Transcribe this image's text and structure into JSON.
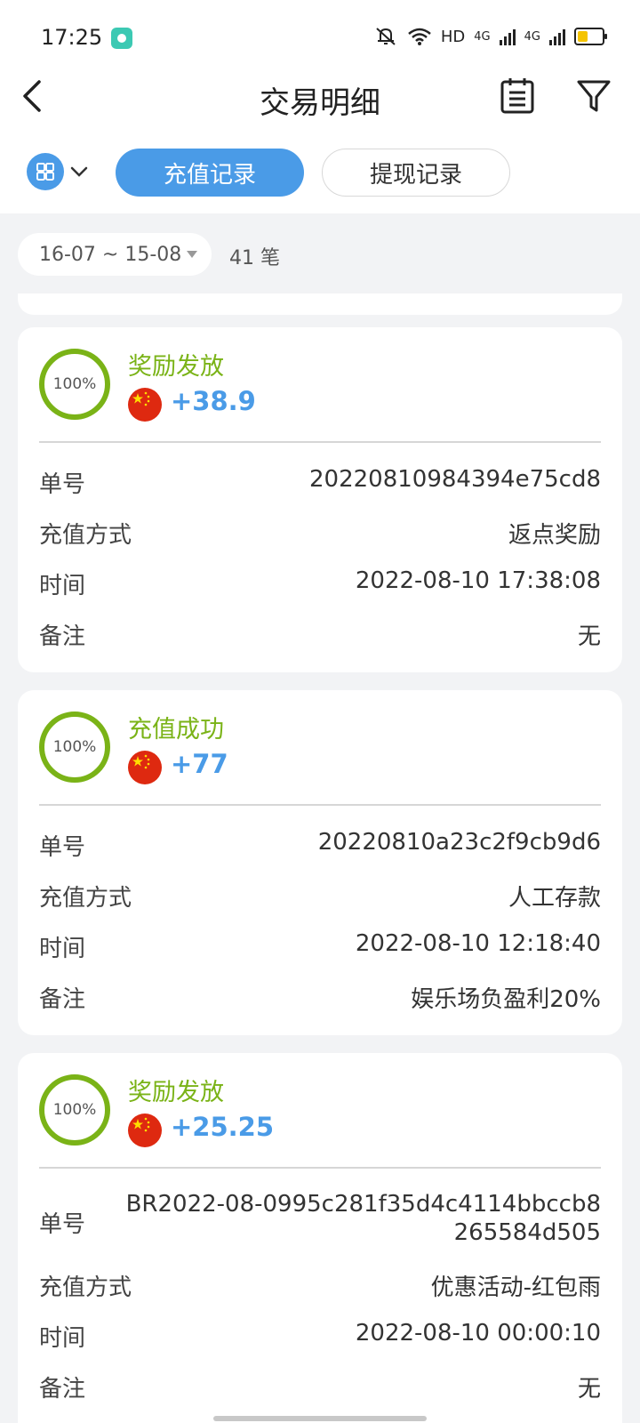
{
  "status_bar": {
    "time": "17:25",
    "network": "HD",
    "signal1": "4G",
    "signal2": "4G"
  },
  "header": {
    "title": "交易明细",
    "back_icon": "chevron-left-icon",
    "calendar_icon": "calendar-icon",
    "filter_icon": "filter-icon"
  },
  "tabs": {
    "recharge": "充值记录",
    "withdraw": "提现记录"
  },
  "filter": {
    "date_range": "16-07 ~ 15-08",
    "count": "41 笔"
  },
  "labels": {
    "order_no": "单号",
    "method": "充值方式",
    "time": "时间",
    "note": "备注"
  },
  "records": [
    {
      "progress": "100%",
      "status": "奖励发放",
      "amount": "+38.9",
      "order_no": "20220810984394e75cd8",
      "method": "返点奖励",
      "time": "2022-08-10 17:38:08",
      "note": "无"
    },
    {
      "progress": "100%",
      "status": "充值成功",
      "amount": "+77",
      "order_no": "20220810a23c2f9cb9d6",
      "method": "人工存款",
      "time": "2022-08-10 12:18:40",
      "note": "娱乐场负盈利20%"
    },
    {
      "progress": "100%",
      "status": "奖励发放",
      "amount": "+25.25",
      "order_no": "BR2022-08-0995c281f35d4c4114bbccb8265584d505",
      "method": "优惠活动-红包雨",
      "time": "2022-08-10 00:00:10",
      "note": "无"
    }
  ],
  "colors": {
    "accent": "#4a9be7",
    "success": "#7ab317",
    "background": "#f2f3f5"
  }
}
